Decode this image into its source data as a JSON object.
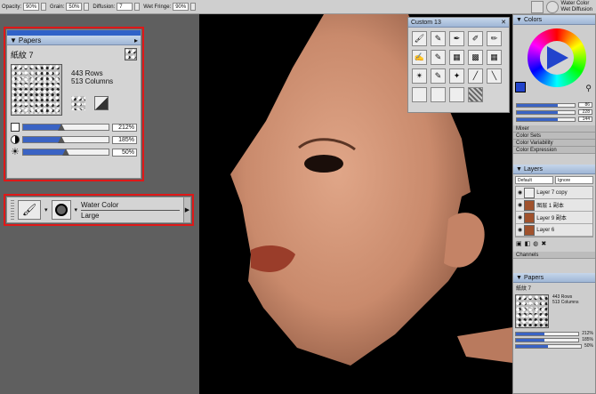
{
  "toolbar": {
    "opacity_label": "Opacity:",
    "opacity_value": "90%",
    "grain_label": "Grain:",
    "grain_value": "50%",
    "diffusion_label": "Diffusion:",
    "diffusion_value": "7",
    "wet_fringe_label": "Wet Fringe:",
    "wet_fringe_value": "90%",
    "brush_category": "Water Color",
    "brush_variant": "Wet Diffusion"
  },
  "papers": {
    "title": "Papers",
    "paper_name": "紙紋 7",
    "rows": "443 Rows",
    "columns": "513 Columns",
    "scale": "212%",
    "contrast": "185%",
    "brightness": "50%",
    "scale_level": 0.45,
    "contrast_level": 0.45,
    "brightness_level": 0.5
  },
  "brush_selector": {
    "category": "Water Color",
    "variant": "Large"
  },
  "custom": {
    "title": "Custom 13"
  },
  "colors": {
    "title": "Colors",
    "values": [
      "86",
      "228",
      "144"
    ],
    "sections": [
      "Mixer",
      "Color Sets",
      "Color Variability",
      "Color Expression"
    ]
  },
  "layers": {
    "title": "Layers",
    "composite_method": "Default",
    "composite_depth": "Ignore",
    "items": [
      "Layer 7 copy",
      "图层 1 副本",
      "Layer 9 副本",
      "Layer 6"
    ]
  },
  "channels": {
    "title": "Channels"
  },
  "papers_small": {
    "title": "Papers",
    "paper_name": "紙紋 7",
    "rows": "443 Rows",
    "columns": "513 Columns",
    "scale": "212%",
    "contrast": "185%",
    "brightness": "50%"
  },
  "accent_colors": {
    "highlight_border": "#e01818",
    "slider_fill": "#3a63c4",
    "canvas_bg": "#000000",
    "skin": "#c98a6c"
  }
}
